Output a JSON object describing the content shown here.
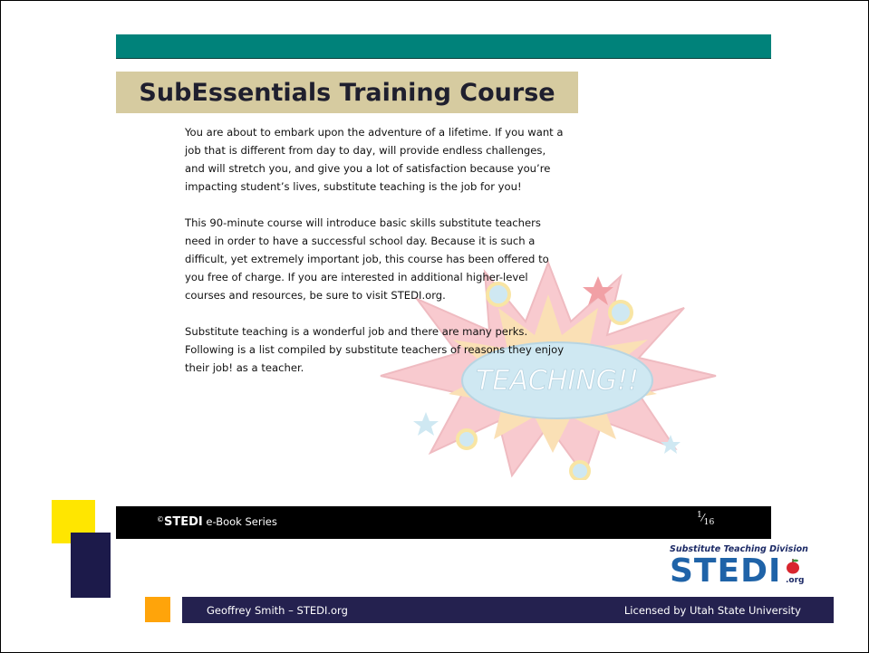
{
  "slide": {
    "title": "SubEssentials Training Course",
    "paragraphs": [
      "You are about to embark upon the adventure of a lifetime. If you want a job that is different from day to day, will provide endless challenges, and will stretch you, and give you a lot of satisfaction because you’re impacting student’s lives, substitute teaching is the job for you!",
      "This 90-minute course will introduce basic skills substitute teachers need in order to have a successful school day. Because it is such a difficult, yet extremely important job, this course has been offered to you free of charge. If you are interested in additional higher-level courses and resources, be sure to visit STEDI.org.",
      "Substitute teaching is a wonderful job and there are many perks. Following is a list compiled by substitute teachers of reasons they enjoy their job! as a teacher."
    ],
    "burst_text": "TEACHING!!"
  },
  "footer": {
    "copyright": "©",
    "brand": "STEDI",
    "series": " e-Book Series",
    "page_num_numerator": "1",
    "page_num_denominator": "16"
  },
  "logo": {
    "division": "Substitute Teaching Division",
    "word": "STEDI",
    "org": ".org"
  },
  "nav_bar": {
    "left": "Geoffrey Smith – STEDI.org",
    "right": "Licensed by Utah State University"
  },
  "colors": {
    "teal": "#00827a",
    "banner": "#d6cba0",
    "navy": "#24214f",
    "yellow": "#ffe600",
    "orange": "#ffa40a",
    "stedi_blue": "#1f63a8"
  }
}
